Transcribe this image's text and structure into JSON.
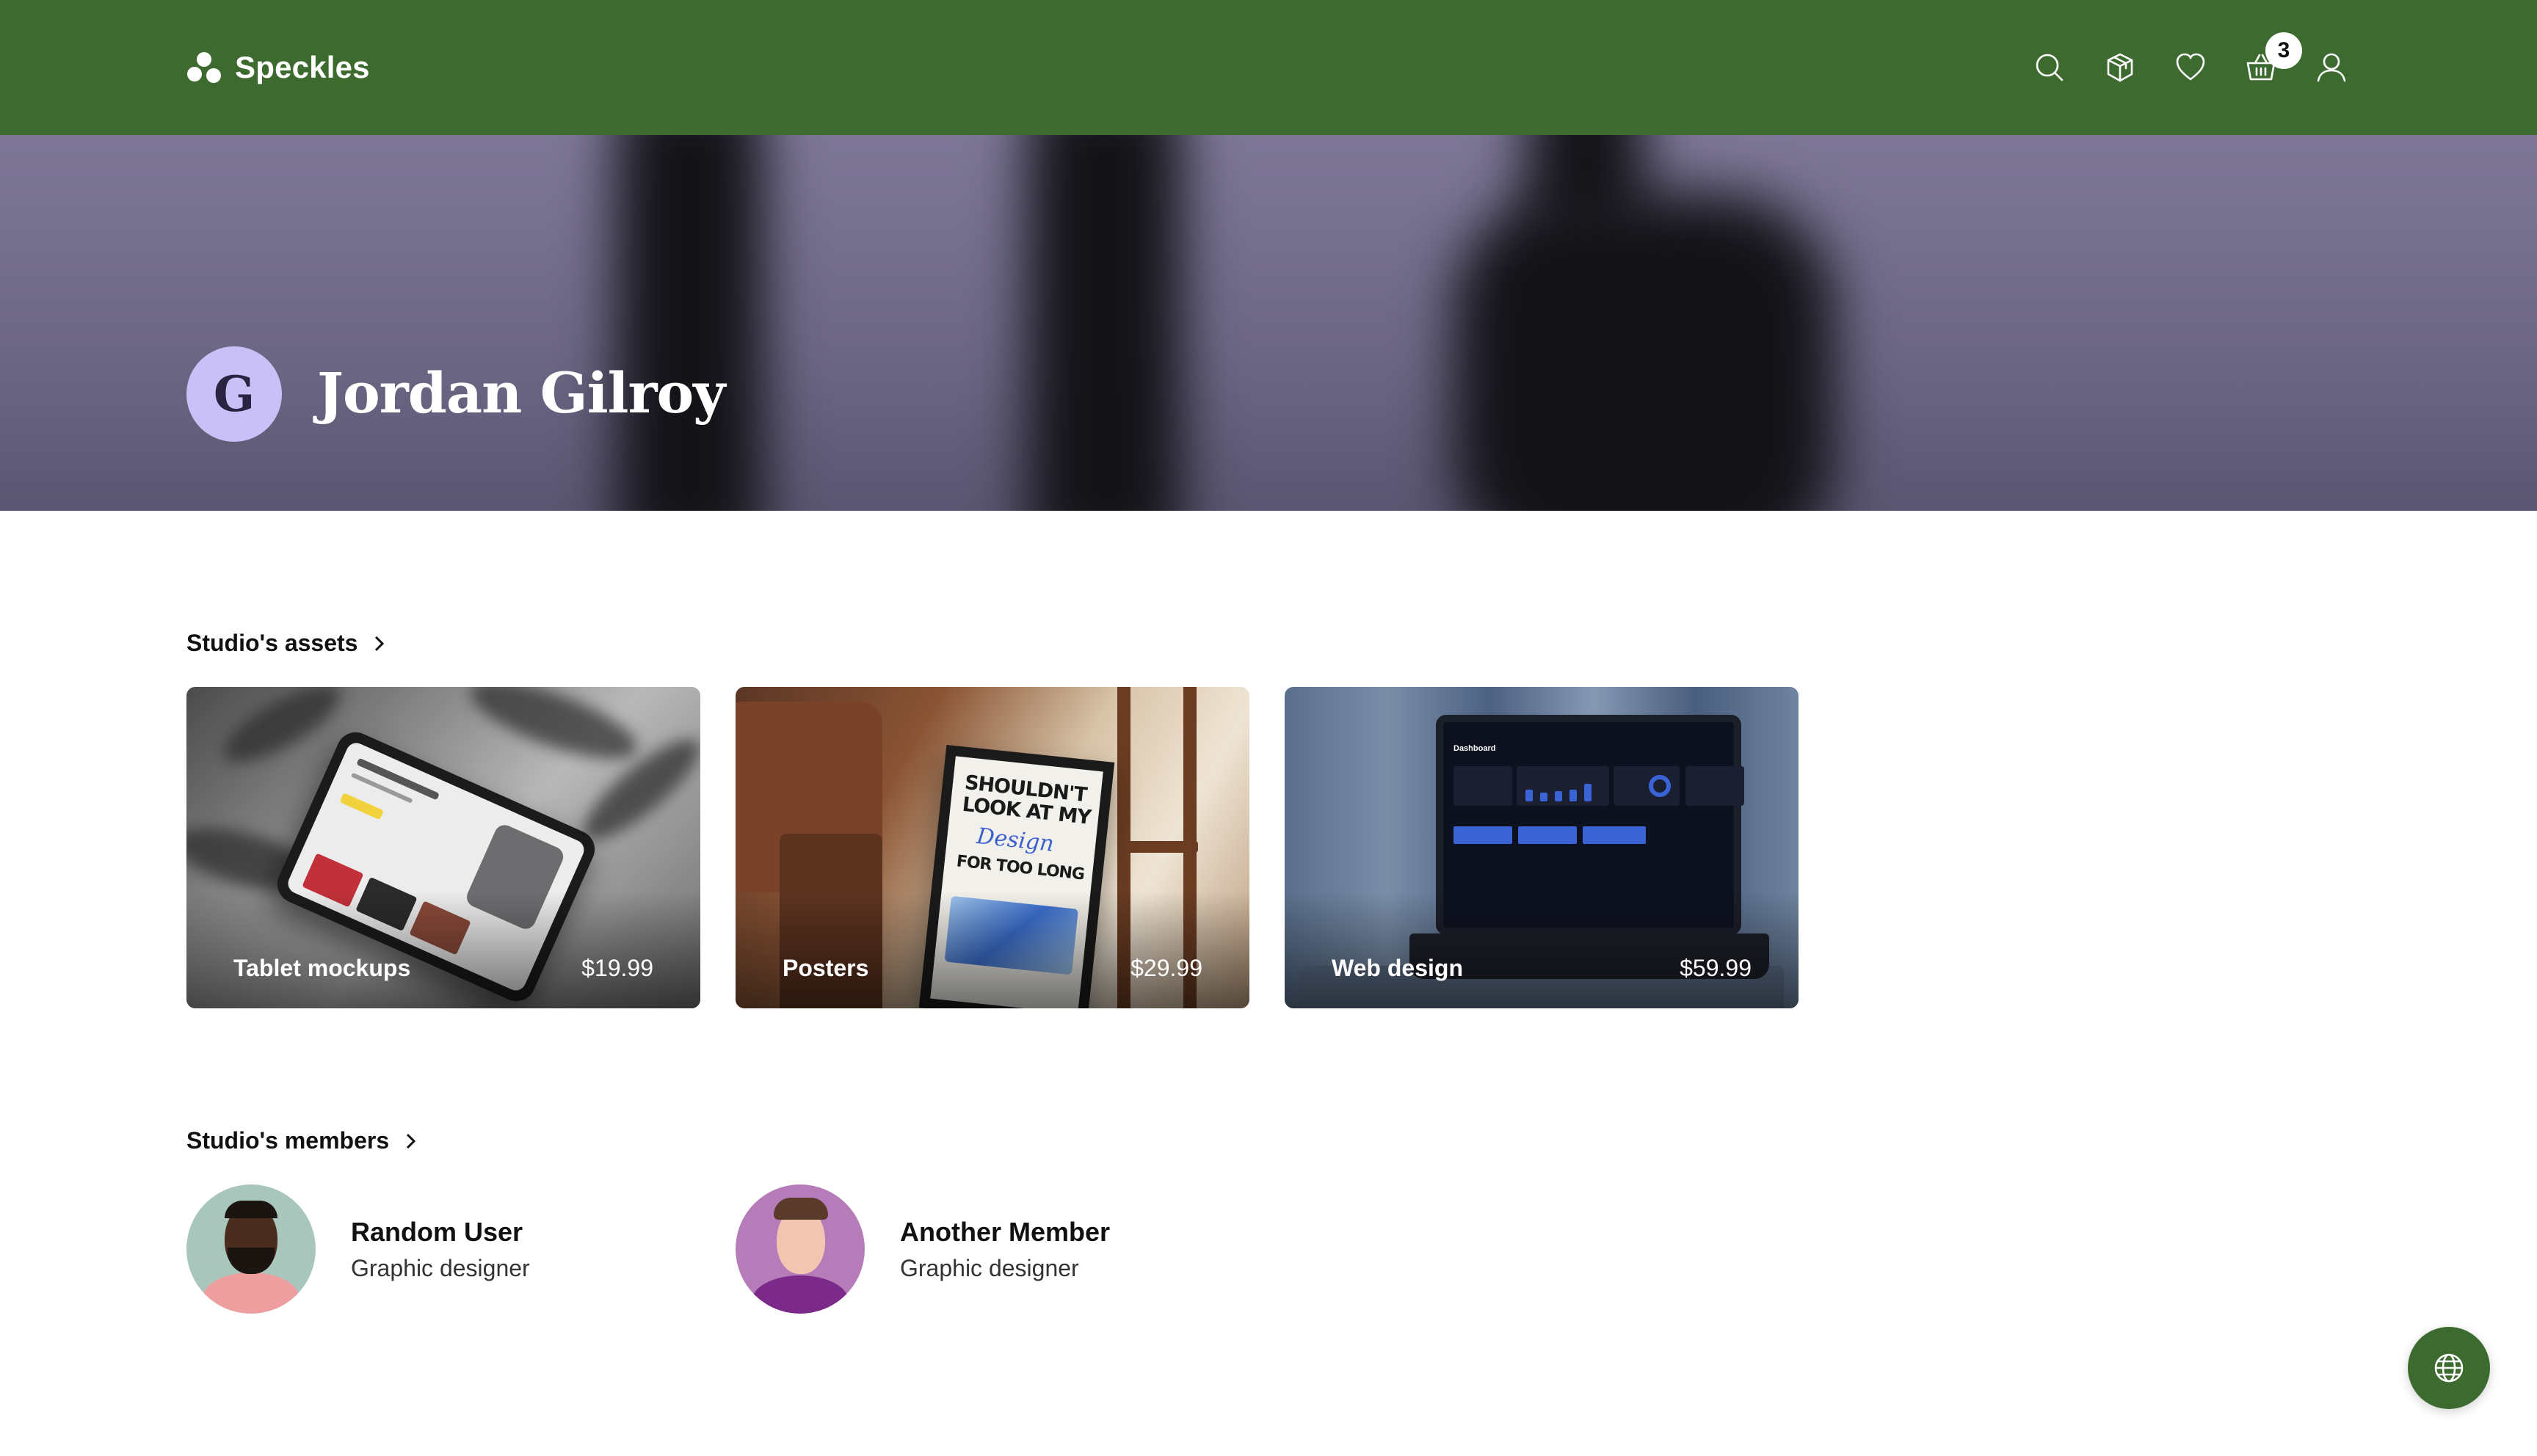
{
  "brand": {
    "name": "Speckles"
  },
  "colors": {
    "brand_green": "#3d6b2f",
    "avatar_bg": "#c9c0f7",
    "hero_tint": "#7e7797"
  },
  "navbar": {
    "icons": [
      "search-icon",
      "box-icon",
      "heart-icon",
      "basket-icon",
      "user-icon"
    ],
    "cart_count": "3"
  },
  "profile": {
    "monogram": "G",
    "name": "Jordan Gilroy"
  },
  "assets_section": {
    "heading": "Studio's assets",
    "items": [
      {
        "title": "Tablet mockups",
        "price": "$19.99"
      },
      {
        "title": "Posters",
        "price": "$29.99"
      },
      {
        "title": "Web design",
        "price": "$59.99"
      }
    ]
  },
  "members_section": {
    "heading": "Studio's members",
    "members": [
      {
        "name": "Random User",
        "role": "Graphic designer"
      },
      {
        "name": "Another Member",
        "role": "Graphic designer"
      }
    ]
  },
  "artwork": {
    "poster_text": "SHOULDN'T LOOK AT MY",
    "poster_script": "Design",
    "poster_subtext": "FOR TOO LONG",
    "dashboard_title": "Dashboard"
  },
  "floating": {
    "icon": "globe-icon"
  }
}
